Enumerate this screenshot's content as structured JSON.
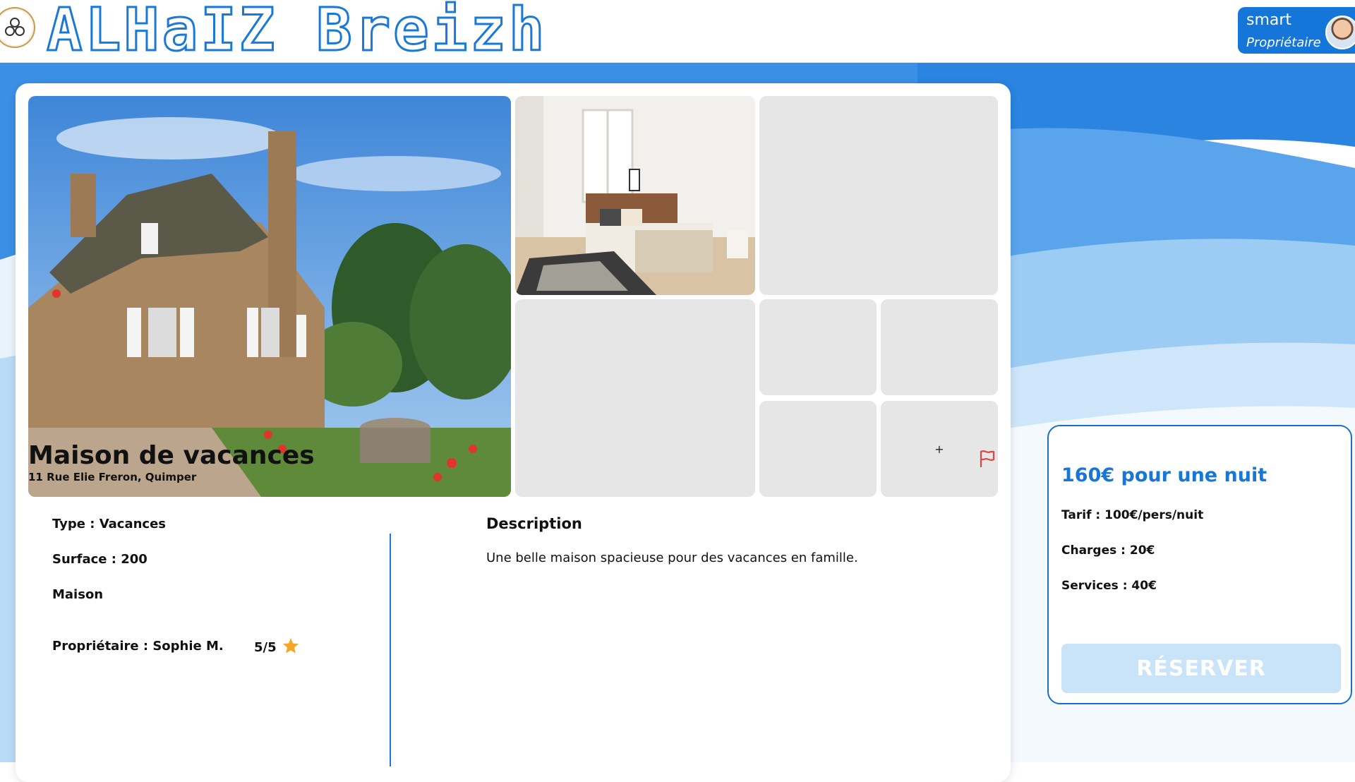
{
  "header": {
    "brand": "ALHaIZ Breizh",
    "user": {
      "name": "smart",
      "role": "Propriétaire"
    }
  },
  "listing": {
    "title": "Maison de vacances",
    "address": "11 Rue Elie Freron, Quimper",
    "gallery": {
      "more_label": "+"
    },
    "info": {
      "type": "Type : Vacances",
      "surface": "Surface : 200",
      "category": "Maison",
      "owner": "Propriétaire : Sophie M.",
      "rating": "5/5"
    },
    "description": {
      "heading": "Description",
      "text": "Une belle maison spacieuse pour des vacances en famille."
    }
  },
  "booking": {
    "price": "160€ pour une nuit",
    "tarif": "Tarif : 100€/pers/nuit",
    "charges": "Charges : 20€",
    "services": "Services : 40€",
    "reserve_label": "RÉSERVER"
  },
  "colors": {
    "accent": "#1677d6",
    "reserve_disabled": "#c9e3f8",
    "flag": "#e04545",
    "star": "#f5a623"
  },
  "icons": [
    "triskel-logo-icon",
    "flag-icon",
    "star-icon",
    "avatar-image"
  ]
}
